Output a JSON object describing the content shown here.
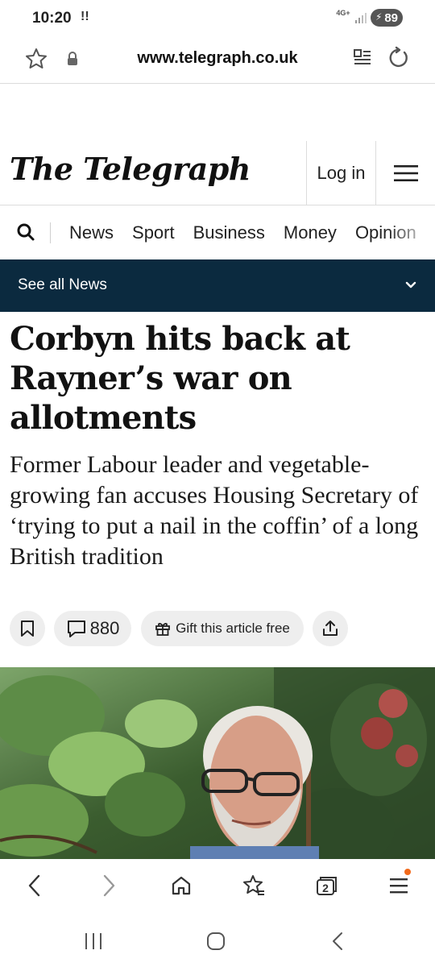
{
  "status_bar": {
    "time": "10:20",
    "notification_glyph": "!!",
    "network": "4G+",
    "battery": "89",
    "icons": [
      "notification-icon",
      "signal-icon",
      "battery-icon"
    ]
  },
  "address_bar": {
    "url": "www.telegraph.co.uk",
    "icons": [
      "star-icon",
      "lock-icon",
      "reader-mode-icon",
      "refresh-icon"
    ]
  },
  "header": {
    "masthead": "The Telegraph",
    "login_label": "Log in",
    "icons": [
      "hamburger-menu-icon"
    ]
  },
  "nav": {
    "items": [
      "News",
      "Sport",
      "Business",
      "Money",
      "Opinion"
    ],
    "icons": [
      "search-icon"
    ]
  },
  "section_bar": {
    "label": "See all News",
    "icons": [
      "chevron-down-icon"
    ]
  },
  "article": {
    "headline": "Corbyn hits back at Rayner’s war on allotments",
    "standfirst": "Former Labour leader and vegetable-growing fan accuses Housing Secretary of ‘trying to put a nail in the coffin’ of a long British tradition",
    "comment_count": "880",
    "gift_label": "Gift this article free",
    "icons": [
      "bookmark-icon",
      "comment-icon",
      "gift-icon",
      "share-icon"
    ]
  },
  "browser_toolbar": {
    "tab_count": "2",
    "icons": [
      "back-arrow-icon",
      "forward-arrow-icon",
      "home-icon",
      "bookmarks-star-icon",
      "tabs-icon",
      "browser-menu-icon"
    ]
  },
  "system_nav": {
    "icons": [
      "recents-icon",
      "system-home-icon",
      "system-back-icon"
    ]
  },
  "colors": {
    "section_bar_bg": "#0b2a3f",
    "notification_dot": "#f26a1b"
  }
}
